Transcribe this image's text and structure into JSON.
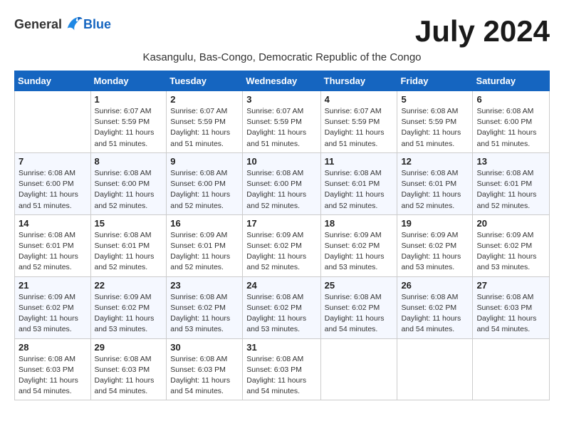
{
  "logo": {
    "general": "General",
    "blue": "Blue"
  },
  "month_title": "July 2024",
  "location": "Kasangulu, Bas-Congo, Democratic Republic of the Congo",
  "days_of_week": [
    "Sunday",
    "Monday",
    "Tuesday",
    "Wednesday",
    "Thursday",
    "Friday",
    "Saturday"
  ],
  "weeks": [
    [
      {
        "day": "",
        "sunrise": "",
        "sunset": "",
        "daylight": ""
      },
      {
        "day": "1",
        "sunrise": "Sunrise: 6:07 AM",
        "sunset": "Sunset: 5:59 PM",
        "daylight": "Daylight: 11 hours and 51 minutes."
      },
      {
        "day": "2",
        "sunrise": "Sunrise: 6:07 AM",
        "sunset": "Sunset: 5:59 PM",
        "daylight": "Daylight: 11 hours and 51 minutes."
      },
      {
        "day": "3",
        "sunrise": "Sunrise: 6:07 AM",
        "sunset": "Sunset: 5:59 PM",
        "daylight": "Daylight: 11 hours and 51 minutes."
      },
      {
        "day": "4",
        "sunrise": "Sunrise: 6:07 AM",
        "sunset": "Sunset: 5:59 PM",
        "daylight": "Daylight: 11 hours and 51 minutes."
      },
      {
        "day": "5",
        "sunrise": "Sunrise: 6:08 AM",
        "sunset": "Sunset: 5:59 PM",
        "daylight": "Daylight: 11 hours and 51 minutes."
      },
      {
        "day": "6",
        "sunrise": "Sunrise: 6:08 AM",
        "sunset": "Sunset: 6:00 PM",
        "daylight": "Daylight: 11 hours and 51 minutes."
      }
    ],
    [
      {
        "day": "7",
        "sunrise": "Sunrise: 6:08 AM",
        "sunset": "Sunset: 6:00 PM",
        "daylight": "Daylight: 11 hours and 51 minutes."
      },
      {
        "day": "8",
        "sunrise": "Sunrise: 6:08 AM",
        "sunset": "Sunset: 6:00 PM",
        "daylight": "Daylight: 11 hours and 52 minutes."
      },
      {
        "day": "9",
        "sunrise": "Sunrise: 6:08 AM",
        "sunset": "Sunset: 6:00 PM",
        "daylight": "Daylight: 11 hours and 52 minutes."
      },
      {
        "day": "10",
        "sunrise": "Sunrise: 6:08 AM",
        "sunset": "Sunset: 6:00 PM",
        "daylight": "Daylight: 11 hours and 52 minutes."
      },
      {
        "day": "11",
        "sunrise": "Sunrise: 6:08 AM",
        "sunset": "Sunset: 6:01 PM",
        "daylight": "Daylight: 11 hours and 52 minutes."
      },
      {
        "day": "12",
        "sunrise": "Sunrise: 6:08 AM",
        "sunset": "Sunset: 6:01 PM",
        "daylight": "Daylight: 11 hours and 52 minutes."
      },
      {
        "day": "13",
        "sunrise": "Sunrise: 6:08 AM",
        "sunset": "Sunset: 6:01 PM",
        "daylight": "Daylight: 11 hours and 52 minutes."
      }
    ],
    [
      {
        "day": "14",
        "sunrise": "Sunrise: 6:08 AM",
        "sunset": "Sunset: 6:01 PM",
        "daylight": "Daylight: 11 hours and 52 minutes."
      },
      {
        "day": "15",
        "sunrise": "Sunrise: 6:08 AM",
        "sunset": "Sunset: 6:01 PM",
        "daylight": "Daylight: 11 hours and 52 minutes."
      },
      {
        "day": "16",
        "sunrise": "Sunrise: 6:09 AM",
        "sunset": "Sunset: 6:01 PM",
        "daylight": "Daylight: 11 hours and 52 minutes."
      },
      {
        "day": "17",
        "sunrise": "Sunrise: 6:09 AM",
        "sunset": "Sunset: 6:02 PM",
        "daylight": "Daylight: 11 hours and 52 minutes."
      },
      {
        "day": "18",
        "sunrise": "Sunrise: 6:09 AM",
        "sunset": "Sunset: 6:02 PM",
        "daylight": "Daylight: 11 hours and 53 minutes."
      },
      {
        "day": "19",
        "sunrise": "Sunrise: 6:09 AM",
        "sunset": "Sunset: 6:02 PM",
        "daylight": "Daylight: 11 hours and 53 minutes."
      },
      {
        "day": "20",
        "sunrise": "Sunrise: 6:09 AM",
        "sunset": "Sunset: 6:02 PM",
        "daylight": "Daylight: 11 hours and 53 minutes."
      }
    ],
    [
      {
        "day": "21",
        "sunrise": "Sunrise: 6:09 AM",
        "sunset": "Sunset: 6:02 PM",
        "daylight": "Daylight: 11 hours and 53 minutes."
      },
      {
        "day": "22",
        "sunrise": "Sunrise: 6:09 AM",
        "sunset": "Sunset: 6:02 PM",
        "daylight": "Daylight: 11 hours and 53 minutes."
      },
      {
        "day": "23",
        "sunrise": "Sunrise: 6:08 AM",
        "sunset": "Sunset: 6:02 PM",
        "daylight": "Daylight: 11 hours and 53 minutes."
      },
      {
        "day": "24",
        "sunrise": "Sunrise: 6:08 AM",
        "sunset": "Sunset: 6:02 PM",
        "daylight": "Daylight: 11 hours and 53 minutes."
      },
      {
        "day": "25",
        "sunrise": "Sunrise: 6:08 AM",
        "sunset": "Sunset: 6:02 PM",
        "daylight": "Daylight: 11 hours and 54 minutes."
      },
      {
        "day": "26",
        "sunrise": "Sunrise: 6:08 AM",
        "sunset": "Sunset: 6:02 PM",
        "daylight": "Daylight: 11 hours and 54 minutes."
      },
      {
        "day": "27",
        "sunrise": "Sunrise: 6:08 AM",
        "sunset": "Sunset: 6:03 PM",
        "daylight": "Daylight: 11 hours and 54 minutes."
      }
    ],
    [
      {
        "day": "28",
        "sunrise": "Sunrise: 6:08 AM",
        "sunset": "Sunset: 6:03 PM",
        "daylight": "Daylight: 11 hours and 54 minutes."
      },
      {
        "day": "29",
        "sunrise": "Sunrise: 6:08 AM",
        "sunset": "Sunset: 6:03 PM",
        "daylight": "Daylight: 11 hours and 54 minutes."
      },
      {
        "day": "30",
        "sunrise": "Sunrise: 6:08 AM",
        "sunset": "Sunset: 6:03 PM",
        "daylight": "Daylight: 11 hours and 54 minutes."
      },
      {
        "day": "31",
        "sunrise": "Sunrise: 6:08 AM",
        "sunset": "Sunset: 6:03 PM",
        "daylight": "Daylight: 11 hours and 54 minutes."
      },
      {
        "day": "",
        "sunrise": "",
        "sunset": "",
        "daylight": ""
      },
      {
        "day": "",
        "sunrise": "",
        "sunset": "",
        "daylight": ""
      },
      {
        "day": "",
        "sunrise": "",
        "sunset": "",
        "daylight": ""
      }
    ]
  ]
}
